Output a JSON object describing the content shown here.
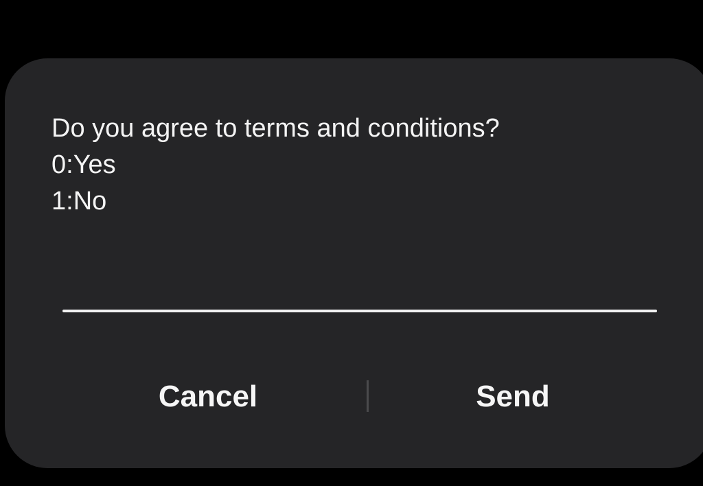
{
  "dialog": {
    "message_lines": [
      "Do you agree to terms and conditions?",
      "0:Yes",
      "1:No"
    ],
    "input": {
      "value": "",
      "placeholder": ""
    },
    "actions": {
      "cancel_label": "Cancel",
      "send_label": "Send"
    }
  },
  "colors": {
    "background": "#000000",
    "dialog_surface": "#252527",
    "text": "#f4f4f4",
    "underline": "#f2f2f2",
    "divider": "#4a4a4c"
  }
}
